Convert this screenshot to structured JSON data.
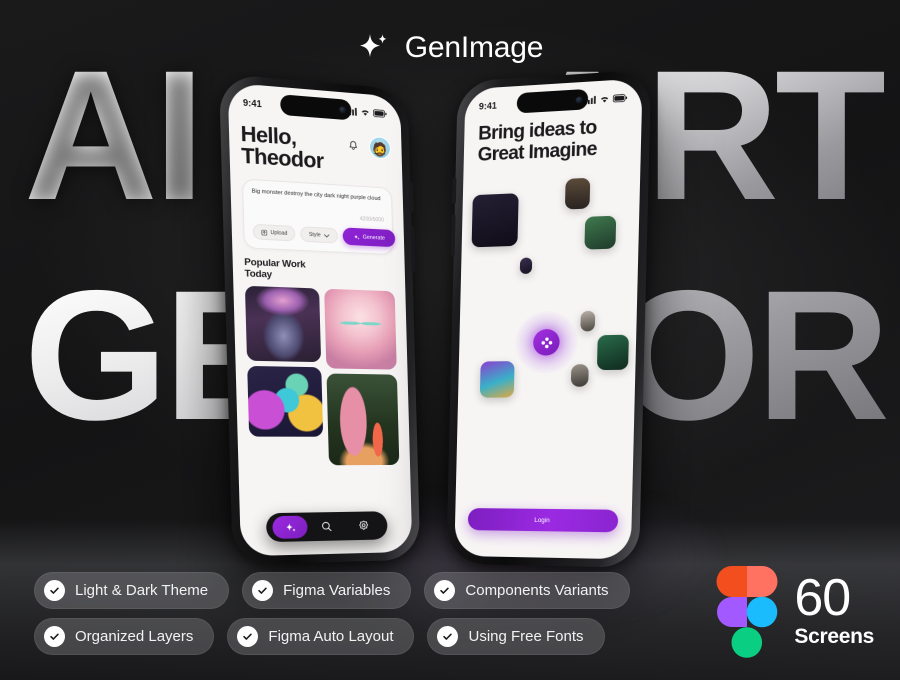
{
  "brand": {
    "name": "GenImage",
    "icon": "sparkle-icon"
  },
  "backdrop": {
    "line1_left": "AI",
    "line1_right": "ART",
    "line2_left": "GEN",
    "line2_right": "TOR",
    "full_text": "AI ART GENERATOR"
  },
  "phone_left": {
    "status": {
      "time": "9:41",
      "signal": "cellular-icon",
      "wifi": "wifi-icon",
      "battery": "battery-icon"
    },
    "greeting_line1": "Hello,",
    "greeting_line2": "Theodor",
    "bell": "bell-icon",
    "avatar": "user-avatar",
    "prompt": {
      "text": "Big monster destroy the city dark night purple cloud",
      "counter": "4200/5000",
      "upload_label": "Upload",
      "style_label": "Style",
      "style_caret": "chevron-down-icon",
      "generate_label": "Generate"
    },
    "section_title_line1": "Popular Work",
    "section_title_line2": "Today",
    "gallery": [
      {
        "name": "elf-girl-portrait"
      },
      {
        "name": "pink-mech-warrior"
      },
      {
        "name": "pink-bigfoot-forest"
      },
      {
        "name": "colorful-monsters"
      }
    ],
    "nav": {
      "generate": "sparkle-icon",
      "search": "search-icon",
      "settings": "gear-icon"
    }
  },
  "phone_right": {
    "status": {
      "time": "9:41",
      "signal": "cellular-icon",
      "wifi": "wifi-icon",
      "battery": "battery-icon"
    },
    "title_line1": "Bring ideas to",
    "title_line2": "Great Imagine",
    "orb": "ai-orb-icon",
    "login_label": "Login",
    "floating_images": [
      {
        "name": "dark-demon-cat"
      },
      {
        "name": "crowd-scene"
      },
      {
        "name": "green-character"
      },
      {
        "name": "tiny-dark-thumb"
      },
      {
        "name": "small-portrait"
      },
      {
        "name": "green-gem-creature"
      },
      {
        "name": "colorful-monsters-thumb"
      },
      {
        "name": "grey-figure-thumb"
      }
    ]
  },
  "badges": {
    "row1": [
      {
        "label": "Light & Dark Theme",
        "icon": "check-icon"
      },
      {
        "label": "Figma Variables",
        "icon": "check-icon"
      },
      {
        "label": "Components Variants",
        "icon": "check-icon"
      }
    ],
    "row2": [
      {
        "label": "Organized Layers",
        "icon": "check-icon"
      },
      {
        "label": "Figma Auto Layout",
        "icon": "check-icon"
      },
      {
        "label": "Using Free Fonts",
        "icon": "check-icon"
      }
    ]
  },
  "screens_callout": {
    "logo": "figma-logo",
    "count": "60",
    "label": "Screens"
  },
  "colors": {
    "background": "#151515",
    "accent_purple": "#8f22d6",
    "accent_purple_dark": "#7d1ec0",
    "screen_bg": "#f7f5f4",
    "text_dark": "#1b1a1c",
    "white": "#ffffff",
    "figma_red": "#f24e1e",
    "figma_orange": "#ff7262",
    "figma_purple": "#a259ff",
    "figma_blue": "#1abcfe",
    "figma_green": "#0acf83"
  }
}
